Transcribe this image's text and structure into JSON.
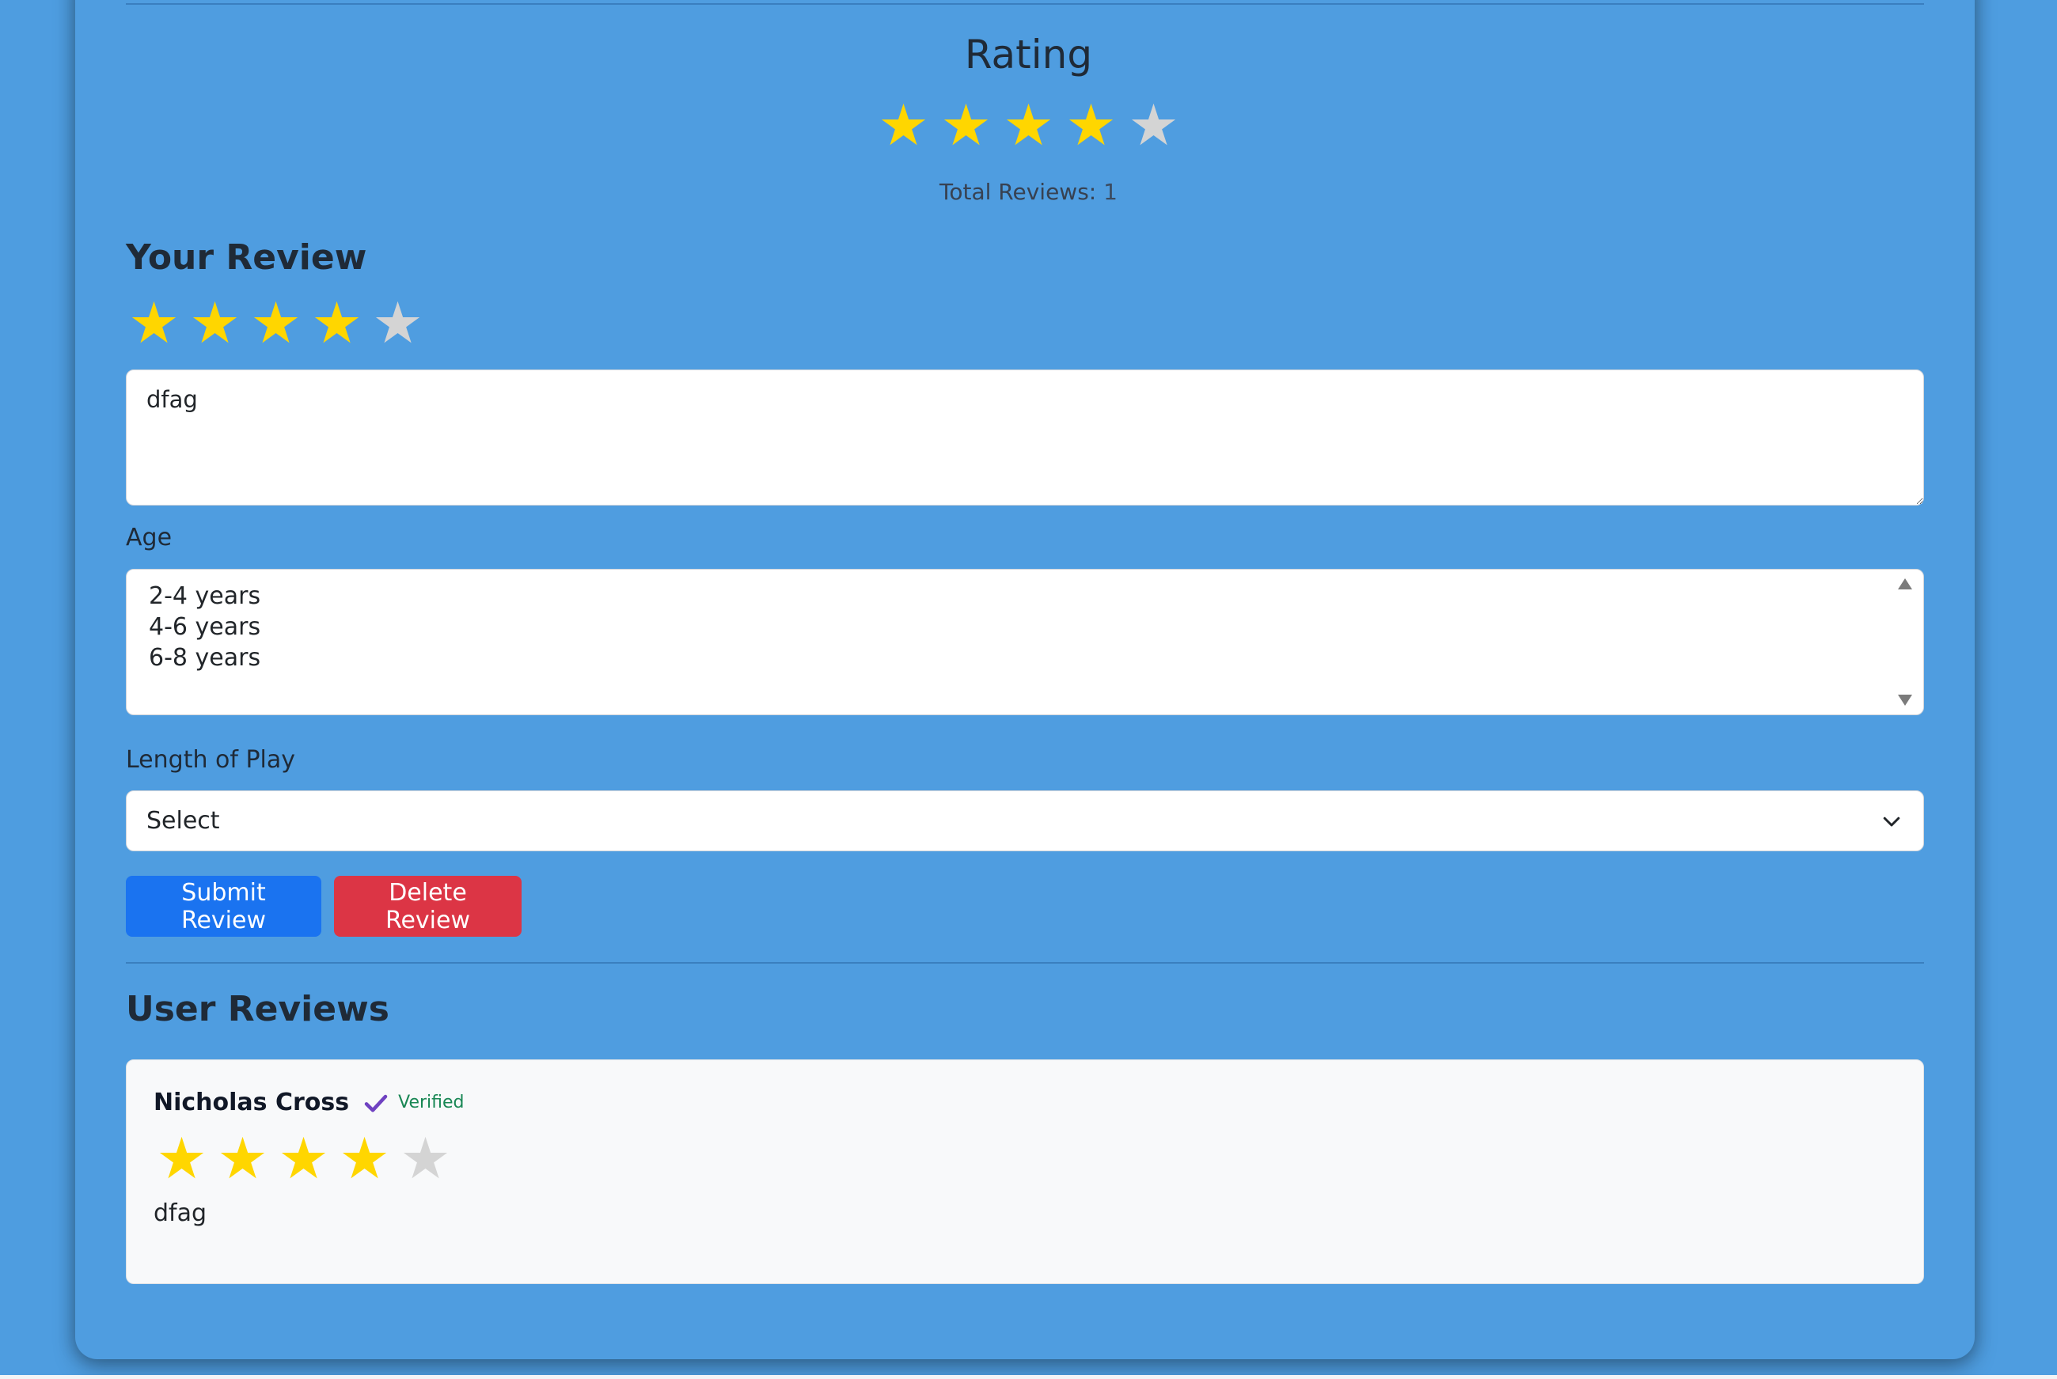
{
  "rating": {
    "title": "Rating",
    "stars_filled": 4,
    "stars_total": 5,
    "total_reviews_label": "Total Reviews:",
    "total_reviews_count": "1"
  },
  "your_review": {
    "title": "Your Review",
    "stars_filled": 4,
    "stars_total": 5,
    "text": "dfag",
    "age_label": "Age",
    "age_options": [
      "2-4 years",
      "4-6 years",
      "6-8 years"
    ],
    "length_label": "Length of Play",
    "length_selected": "Select",
    "submit_label": "Submit Review",
    "delete_label": "Delete Review"
  },
  "user_reviews": {
    "title": "User Reviews",
    "items": [
      {
        "name": "Nicholas Cross",
        "verified_label": "Verified",
        "stars_filled": 4,
        "stars_total": 5,
        "text": "dfag"
      }
    ]
  },
  "colors": {
    "background": "#4e9de0",
    "star_filled": "#ffd600",
    "star_empty": "#d4d4d4",
    "submit": "#1a73f0",
    "delete": "#dc3545",
    "verified": "#198754",
    "check": "#6f42c1"
  },
  "icons": {
    "star": "star-icon",
    "check": "check-icon",
    "chevron": "chevron-down-icon"
  }
}
